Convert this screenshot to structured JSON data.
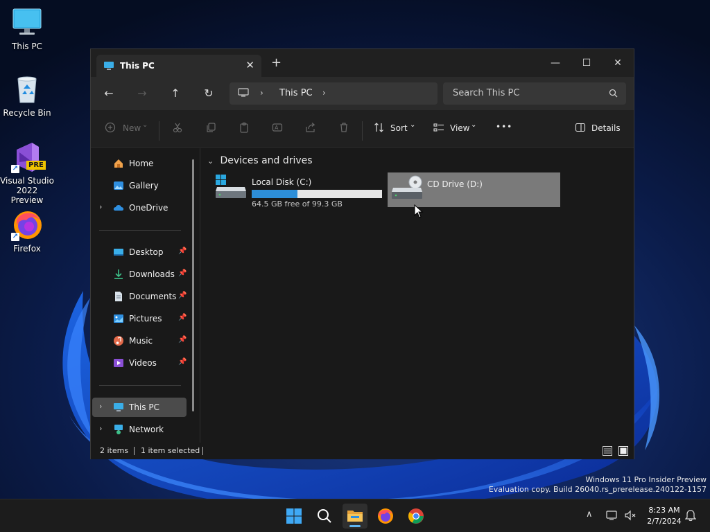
{
  "desktop": {
    "icons": [
      {
        "label": "This PC"
      },
      {
        "label": "Recycle Bin"
      },
      {
        "label": "Visual Studio 2022 Preview",
        "badge": "PRE"
      },
      {
        "label": "Firefox"
      }
    ]
  },
  "explorer": {
    "tab_title": "This PC",
    "tab_close": "✕",
    "new_tab": "+",
    "window_controls": {
      "minimize": "—",
      "maximize": "☐",
      "close": "✕"
    },
    "nav": {
      "back": "←",
      "forward": "→",
      "up": "↑",
      "refresh": "↻"
    },
    "address": {
      "separator": "›",
      "crumb": "This PC"
    },
    "search": {
      "placeholder": "Search This PC"
    },
    "commands": {
      "new_label": "New",
      "sort_label": "Sort",
      "view_label": "View",
      "more_label": "•••",
      "details_label": "Details",
      "dropdown": "⌄"
    },
    "sidebar": {
      "home": "Home",
      "gallery": "Gallery",
      "onedrive": "OneDrive",
      "desktop": "Desktop",
      "downloads": "Downloads",
      "documents": "Documents",
      "pictures": "Pictures",
      "music": "Music",
      "videos": "Videos",
      "this_pc": "This PC",
      "network": "Network",
      "expand_glyph": "›",
      "pin_glyph": "📌"
    },
    "content": {
      "group_title": "Devices and drives",
      "group_chevron": "⌄",
      "drives": [
        {
          "name": "Local Disk (C:)",
          "free_text": "64.5 GB free of 99.3 GB",
          "used_fraction": 0.35
        },
        {
          "name": "CD Drive (D:)"
        }
      ]
    },
    "status": {
      "items": "2 items",
      "selected": "1 item selected"
    }
  },
  "watermark": {
    "line1": "Windows 11 Pro Insider Preview",
    "line2": "Evaluation copy. Build 26040.rs_prerelease.240122-1157"
  },
  "taskbar": {
    "clock_time": "8:23 AM",
    "clock_date": "2/7/2024",
    "tray_chevron": "∧"
  },
  "colors": {
    "accent": "#2d8ed8",
    "selected_drive": "#7a7a7a",
    "window_bg": "#191919"
  }
}
